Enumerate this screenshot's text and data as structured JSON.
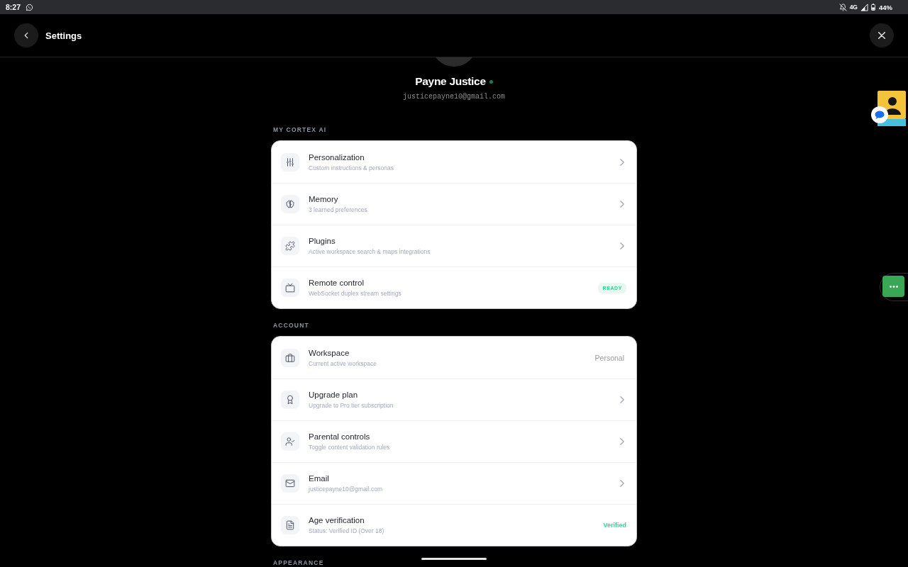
{
  "status_bar": {
    "time": "8:27",
    "network": "4G",
    "battery": "44%"
  },
  "header": {
    "title": "Settings"
  },
  "profile": {
    "name": "Payne Justice",
    "online": true,
    "email": "justicepayne10@gmail.com"
  },
  "sections": [
    {
      "title": "MY CORTEX AI",
      "items": [
        {
          "kind": "link",
          "title": "Personalization",
          "subtitle": "Custom instructions & personas"
        },
        {
          "kind": "link",
          "title": "Memory",
          "subtitle": "3 learned preferences"
        },
        {
          "kind": "link",
          "title": "Plugins",
          "subtitle": "Active workspace search & maps integrations"
        },
        {
          "kind": "badge",
          "title": "Remote control",
          "subtitle": "WebSocket duplex stream settings",
          "badge": "READY"
        }
      ]
    },
    {
      "title": "ACCOUNT",
      "items": [
        {
          "kind": "value",
          "title": "Workspace",
          "subtitle": "Current active workspace",
          "value": "Personal"
        },
        {
          "kind": "link",
          "title": "Upgrade plan",
          "subtitle": "Upgrade to Pro tier subscription"
        },
        {
          "kind": "link",
          "title": "Parental controls",
          "subtitle": "Toggle content validation rules"
        },
        {
          "kind": "link",
          "title": "Email",
          "subtitle": "justicepayne10@gmail.com"
        },
        {
          "kind": "status",
          "title": "Age verification",
          "subtitle": "Status: Verified ID (Over 18)",
          "value": "Verified"
        }
      ]
    },
    {
      "title": "APPEARANCE"
    }
  ]
}
